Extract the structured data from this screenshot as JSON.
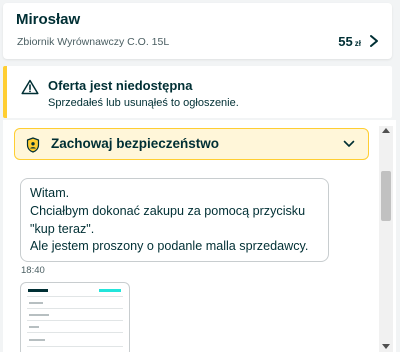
{
  "header": {
    "seller_name": "Mirosław",
    "listing_title": "Zbiornik Wyrównawczy C.O. 15L",
    "price_value": "55",
    "price_currency": "zł",
    "open_icon": "chevron-right-icon"
  },
  "alert": {
    "icon": "warning-triangle-icon",
    "title": "Oferta jest niedostępna",
    "description": "Sprzedałeś lub usunąłeś to ogłoszenie."
  },
  "safety": {
    "icon": "shield-user-icon",
    "label": "Zachowaj bezpieczeństwo",
    "toggle_icon": "chevron-down-icon"
  },
  "messages": [
    {
      "lines": [
        "Witam.",
        "Chciałbym dokonać zakupu za pomocą przycisku",
        "\"kup teraz\".",
        "Ale jestem proszony o podanle malla sprzedawcy."
      ],
      "time": "18:40"
    }
  ],
  "attachment": {
    "type": "image-thumbnail"
  },
  "colors": {
    "accent_yellow": "#ffce32",
    "safety_bg": "#fff6d9",
    "text_primary": "#002f34",
    "page_bg": "#f2f4f5"
  }
}
